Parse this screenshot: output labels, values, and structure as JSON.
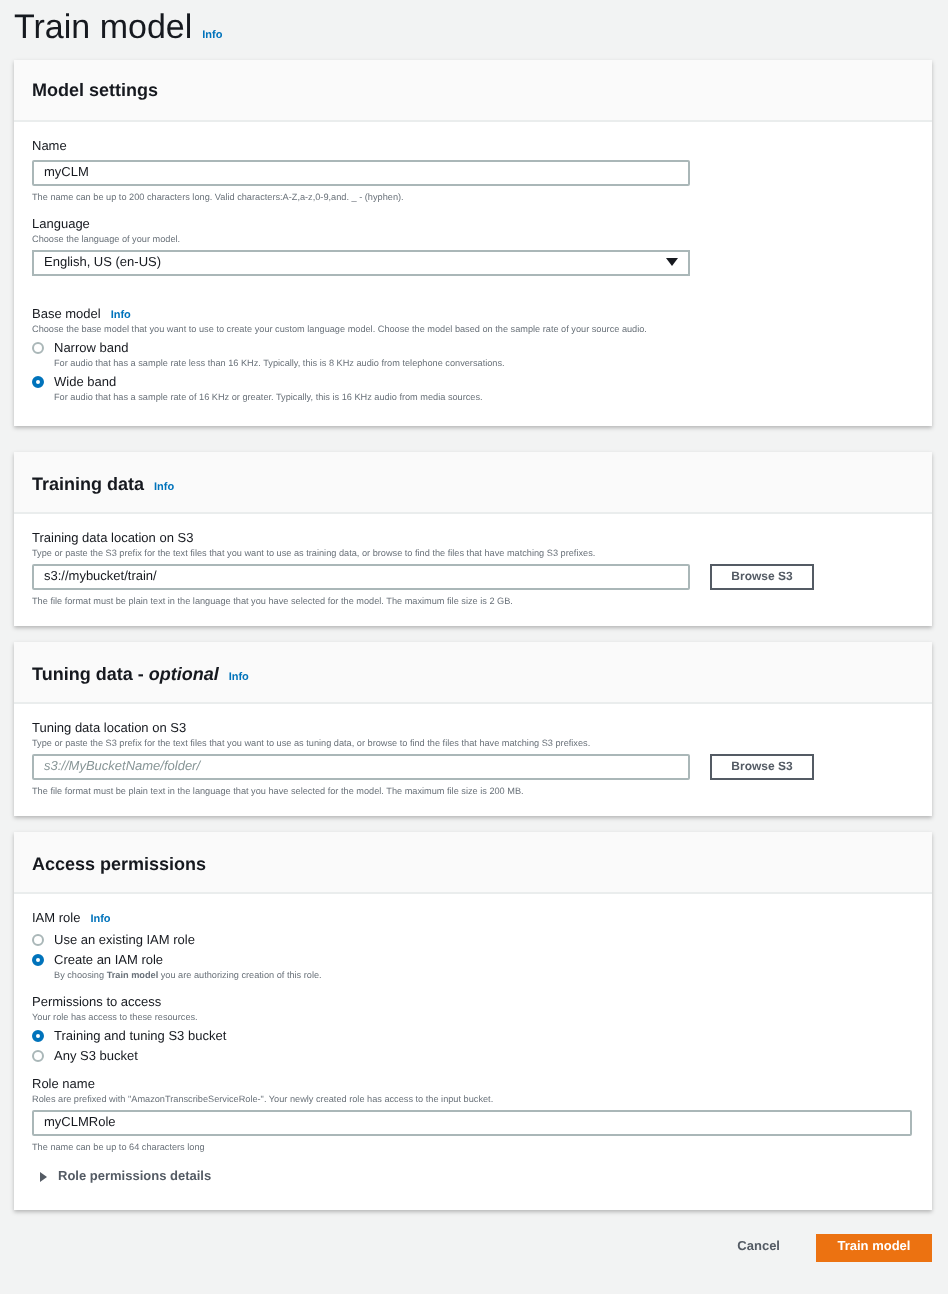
{
  "page": {
    "title": "Train model",
    "info": "Info"
  },
  "model_settings": {
    "title": "Model settings",
    "name_field": {
      "label": "Name",
      "value": "myCLM",
      "hint": "The name can be up to 200 characters long. Valid characters:A-Z,a-z,0-9,and. _ - (hyphen)."
    },
    "language_field": {
      "label": "Language",
      "description": "Choose the language of your model.",
      "value": "English, US (en-US)"
    },
    "base_model": {
      "label": "Base model",
      "info": "Info",
      "description": "Choose the base model that you want to use to create your custom language model. Choose the model based on the sample rate of your source audio.",
      "options": [
        {
          "label": "Narrow band",
          "hint": "For audio that has a sample rate less than 16 KHz. Typically, this is 8 KHz audio from telephone conversations.",
          "selected": false
        },
        {
          "label": "Wide band",
          "hint": "For audio that has a sample rate of 16 KHz or greater. Typically, this is 16 KHz audio from media sources.",
          "selected": true
        }
      ]
    }
  },
  "training_data": {
    "title": "Training data",
    "info": "Info",
    "field": {
      "label": "Training data location on S3",
      "description": "Type or paste the S3 prefix for the text files that you want to use as training data, or browse to find the files that have matching S3 prefixes.",
      "value": "s3://mybucket/train/",
      "hint": "The file format must be plain text in the language that you have selected for the model. The maximum file size is 2 GB."
    },
    "browse_button": "Browse S3"
  },
  "tuning_data": {
    "title": "Tuning data - *optional*",
    "info": "Info",
    "field": {
      "label": "Tuning data location on S3",
      "description": "Type or paste the S3 prefix for the text files that you want to use as tuning data, or browse to find the files that have matching S3 prefixes.",
      "placeholder": "s3://MyBucketName/folder/",
      "hint": "The file format must be plain text in the language that you have selected for the model. The maximum file size is 200 MB."
    },
    "browse_button": "Browse S3"
  },
  "access_permissions": {
    "title": "Access permissions",
    "iam_role": {
      "label": "IAM role",
      "info": "Info",
      "options": [
        {
          "label": "Use an existing IAM role",
          "selected": false
        },
        {
          "label": "Create an IAM role",
          "hint": "By choosing **Train model** you are authorizing creation of this role.",
          "selected": true
        }
      ]
    },
    "permissions": {
      "label": "Permissions to access",
      "description": "Your role has access to these resources.",
      "options": [
        {
          "label": "Training and tuning S3 bucket",
          "selected": true
        },
        {
          "label": "Any S3 bucket",
          "selected": false
        }
      ]
    },
    "role_name": {
      "label": "Role name",
      "description": "Roles are prefixed with \"AmazonTranscribeServiceRole-\". Your newly created role has access to the input bucket.",
      "value": "myCLMRole",
      "hint": "The name can be up to 64 characters long"
    },
    "details": {
      "label": "Role permissions details",
      "expanded": false
    }
  },
  "footer": {
    "cancel": "Cancel",
    "submit": "Train model"
  }
}
